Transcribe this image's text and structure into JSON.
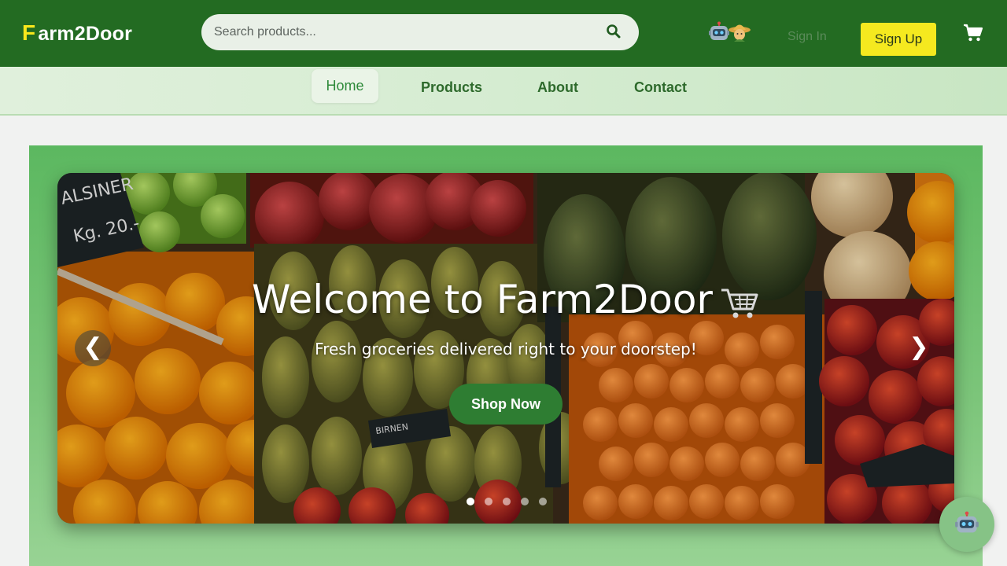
{
  "header": {
    "logo_first": "F",
    "logo_rest": "arm2Door",
    "search_placeholder": "Search products...",
    "signin_label": "Sign In",
    "signup_label": "Sign Up",
    "icons": [
      "search-icon",
      "robot-icon",
      "farmer-icon",
      "cart-icon"
    ]
  },
  "nav": {
    "items": [
      {
        "label": "Home",
        "active": true
      },
      {
        "label": "Products"
      },
      {
        "label": "About"
      },
      {
        "label": "Contact"
      }
    ]
  },
  "hero": {
    "title": "Welcome to Farm2Door",
    "title_icon": "shopping-cart-icon",
    "subtitle": "Fresh groceries delivered right to your doorstep!",
    "cta_label": "Shop Now",
    "prev_label": "❮",
    "next_label": "❯",
    "slide_count": 5,
    "active_slide": 1,
    "background": "fresh fruit market photo"
  },
  "chatbot": {
    "icon": "robot-icon"
  },
  "colors": {
    "header_bg": "#236b22",
    "accent_yellow": "#f5e91f",
    "brand_green": "#2e7d32",
    "nav_bg": "#d5ecd1",
    "hero_frame": "#5cb860"
  }
}
